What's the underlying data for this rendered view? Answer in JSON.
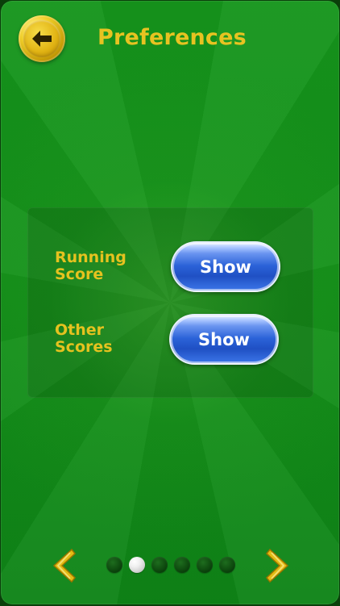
{
  "header": {
    "title": "Preferences",
    "back_icon": "arrow-left-icon"
  },
  "settings": [
    {
      "label": "Running Score",
      "value": "Show"
    },
    {
      "label": "Other Scores",
      "value": "Show"
    }
  ],
  "pagination": {
    "current_page": 2,
    "total_pages": 6
  },
  "navigation": {
    "previous_icon": "chevron-left-icon",
    "next_icon": "chevron-right-icon"
  },
  "colors": {
    "background": "#13901a",
    "title": "#e7c321",
    "label": "#e5c21f",
    "button": "#2b62d8",
    "button_text": "#ffffff",
    "pager_active": "#efefef",
    "pager_inactive": "#0b430c",
    "arrow": "#e3bc13"
  }
}
